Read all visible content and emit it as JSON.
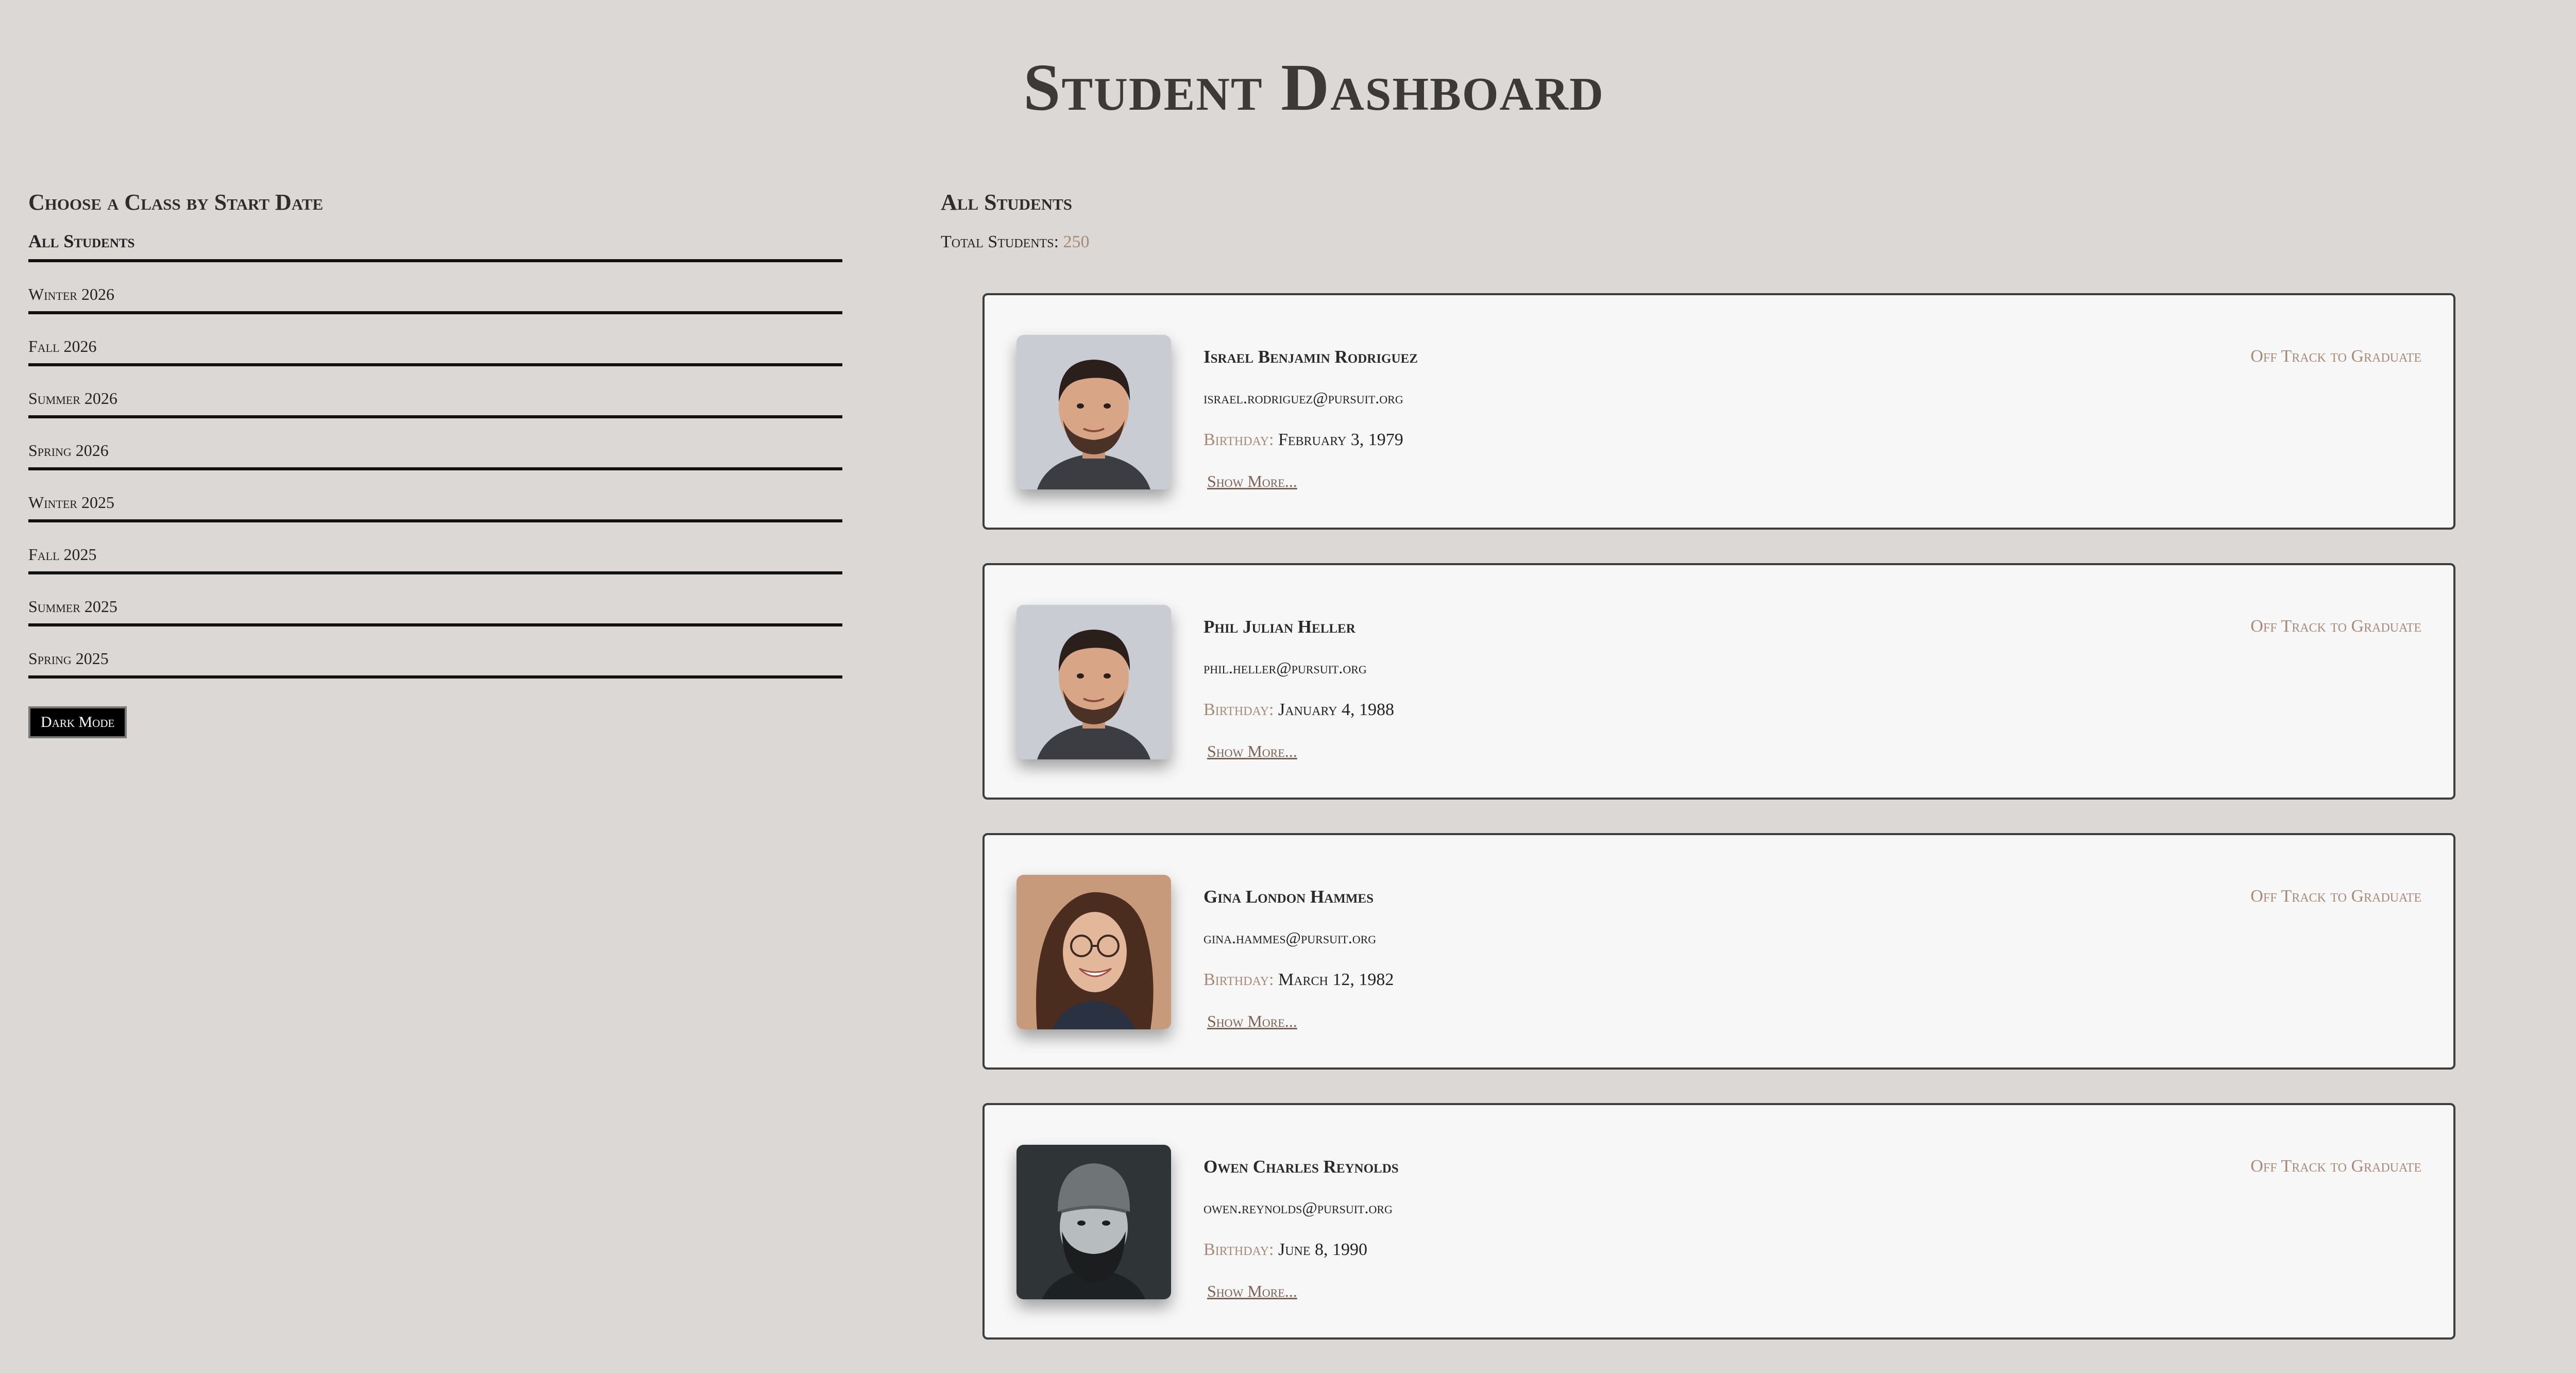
{
  "page": {
    "title": "Student Dashboard"
  },
  "sidebar": {
    "heading": "Choose a Class by Start Date",
    "items": [
      {
        "label": "All Students"
      },
      {
        "label": "Winter 2026"
      },
      {
        "label": "Fall 2026"
      },
      {
        "label": "Summer 2026"
      },
      {
        "label": "Spring 2026"
      },
      {
        "label": "Winter 2025"
      },
      {
        "label": "Fall 2025"
      },
      {
        "label": "Summer 2025"
      },
      {
        "label": "Spring 2025"
      }
    ],
    "dark_mode_label": "Dark Mode"
  },
  "main": {
    "heading": "All Students",
    "total_label": "Total Students:",
    "total_count": "250",
    "students": [
      {
        "name": "Israel Benjamin Rodriguez",
        "email": "israel.rodriguez@pursuit.org",
        "birthday_label": "Birthday:",
        "birthday": "February 3, 1979",
        "show_more": "Show More...",
        "status": "Off Track to Graduate",
        "avatar_icon": "man-portrait-icon"
      },
      {
        "name": "Phil Julian Heller",
        "email": "phil.heller@pursuit.org",
        "birthday_label": "Birthday:",
        "birthday": "January 4, 1988",
        "show_more": "Show More...",
        "status": "Off Track to Graduate",
        "avatar_icon": "man-portrait-icon"
      },
      {
        "name": "Gina London Hammes",
        "email": "gina.hammes@pursuit.org",
        "birthday_label": "Birthday:",
        "birthday": "March 12, 1982",
        "show_more": "Show More...",
        "status": "Off Track to Graduate",
        "avatar_icon": "woman-portrait-icon"
      },
      {
        "name": "Owen Charles Reynolds",
        "email": "owen.reynolds@pursuit.org",
        "birthday_label": "Birthday:",
        "birthday": "June 8, 1990",
        "show_more": "Show More...",
        "status": "Off Track to Graduate",
        "avatar_icon": "bearded-man-portrait-icon"
      }
    ]
  },
  "colors": {
    "background": "#dcd8d5",
    "card_background": "#f7f7f7",
    "accent": "#a68a78",
    "text": "#222222"
  }
}
